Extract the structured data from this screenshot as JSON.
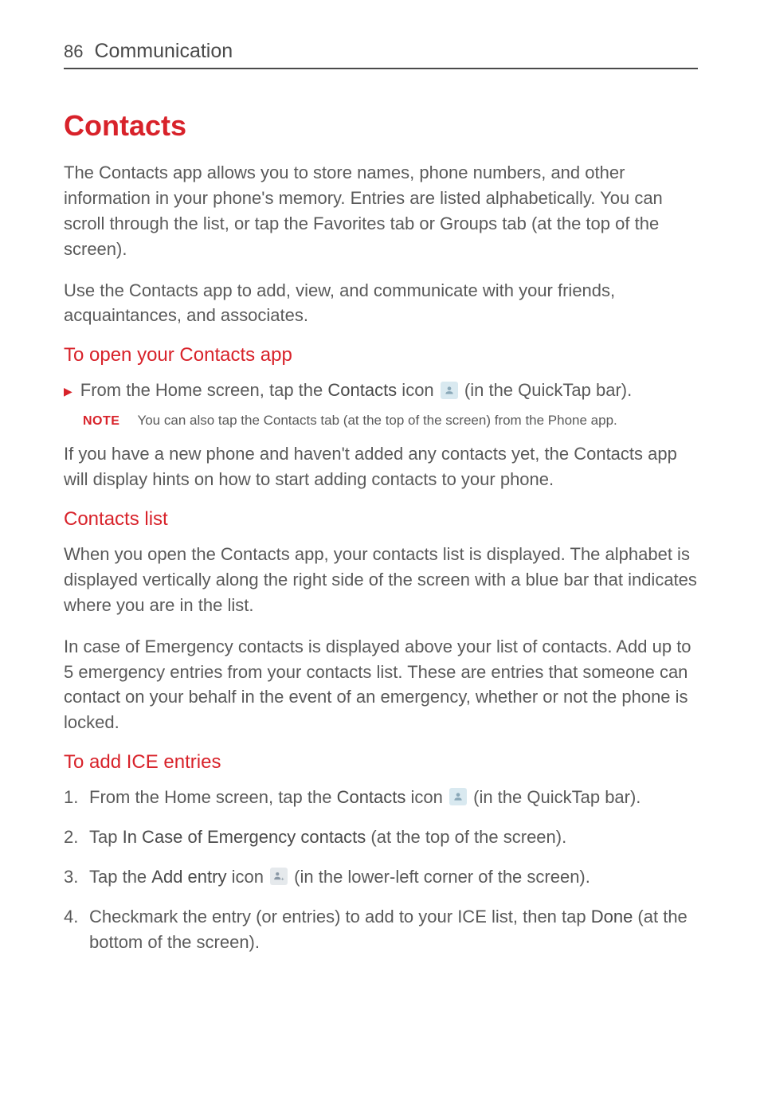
{
  "header": {
    "page_number": "86",
    "section": "Communication"
  },
  "title": "Contacts",
  "intro_p1": "The Contacts app allows you to store names, phone numbers, and other information in your phone's memory. Entries are listed alphabetically. You can scroll through the list, or tap the Favorites tab or Groups tab (at the top of the screen).",
  "intro_p2": "Use the Contacts app to add, view, and communicate with your friends, acquaintances, and associates.",
  "open_heading": "To open your Contacts app",
  "open_bullet": {
    "pre": "From the Home screen, tap the ",
    "bold": "Contacts",
    "mid": " icon ",
    "post": " (in the QuickTap bar)."
  },
  "note": {
    "label": "NOTE",
    "text": "You can also tap the Contacts tab (at the top of the screen) from the Phone app."
  },
  "open_after": "If you have a new phone and haven't added any contacts yet, the Contacts app will display hints on how to start adding contacts to your phone.",
  "list_heading": "Contacts list",
  "list_p1": "When you open the Contacts app, your contacts list is displayed. The alphabet is displayed vertically along the right side of the screen with a blue bar that indicates where you are in the list.",
  "list_p2": "In case of Emergency contacts is displayed above your list of contacts. Add up to 5 emergency entries from your contacts list. These are entries that someone can contact on your behalf in the event of an emergency, whether or not the phone is locked.",
  "ice_heading": "To add ICE entries",
  "ice_steps": {
    "s1": {
      "pre": "From the Home screen, tap the ",
      "bold": "Contacts",
      "mid": " icon ",
      "post": " (in the QuickTap bar)."
    },
    "s2": {
      "pre": "Tap ",
      "bold": "In Case of Emergency contacts",
      "post": " (at the top of the screen)."
    },
    "s3": {
      "pre": "Tap the ",
      "bold": "Add entry",
      "mid": " icon ",
      "post": " (in the lower-left corner of the screen)."
    },
    "s4": {
      "pre": "Checkmark the entry (or entries) to add to your ICE list, then tap ",
      "bold": "Done",
      "post": " (at the bottom of the screen)."
    }
  }
}
